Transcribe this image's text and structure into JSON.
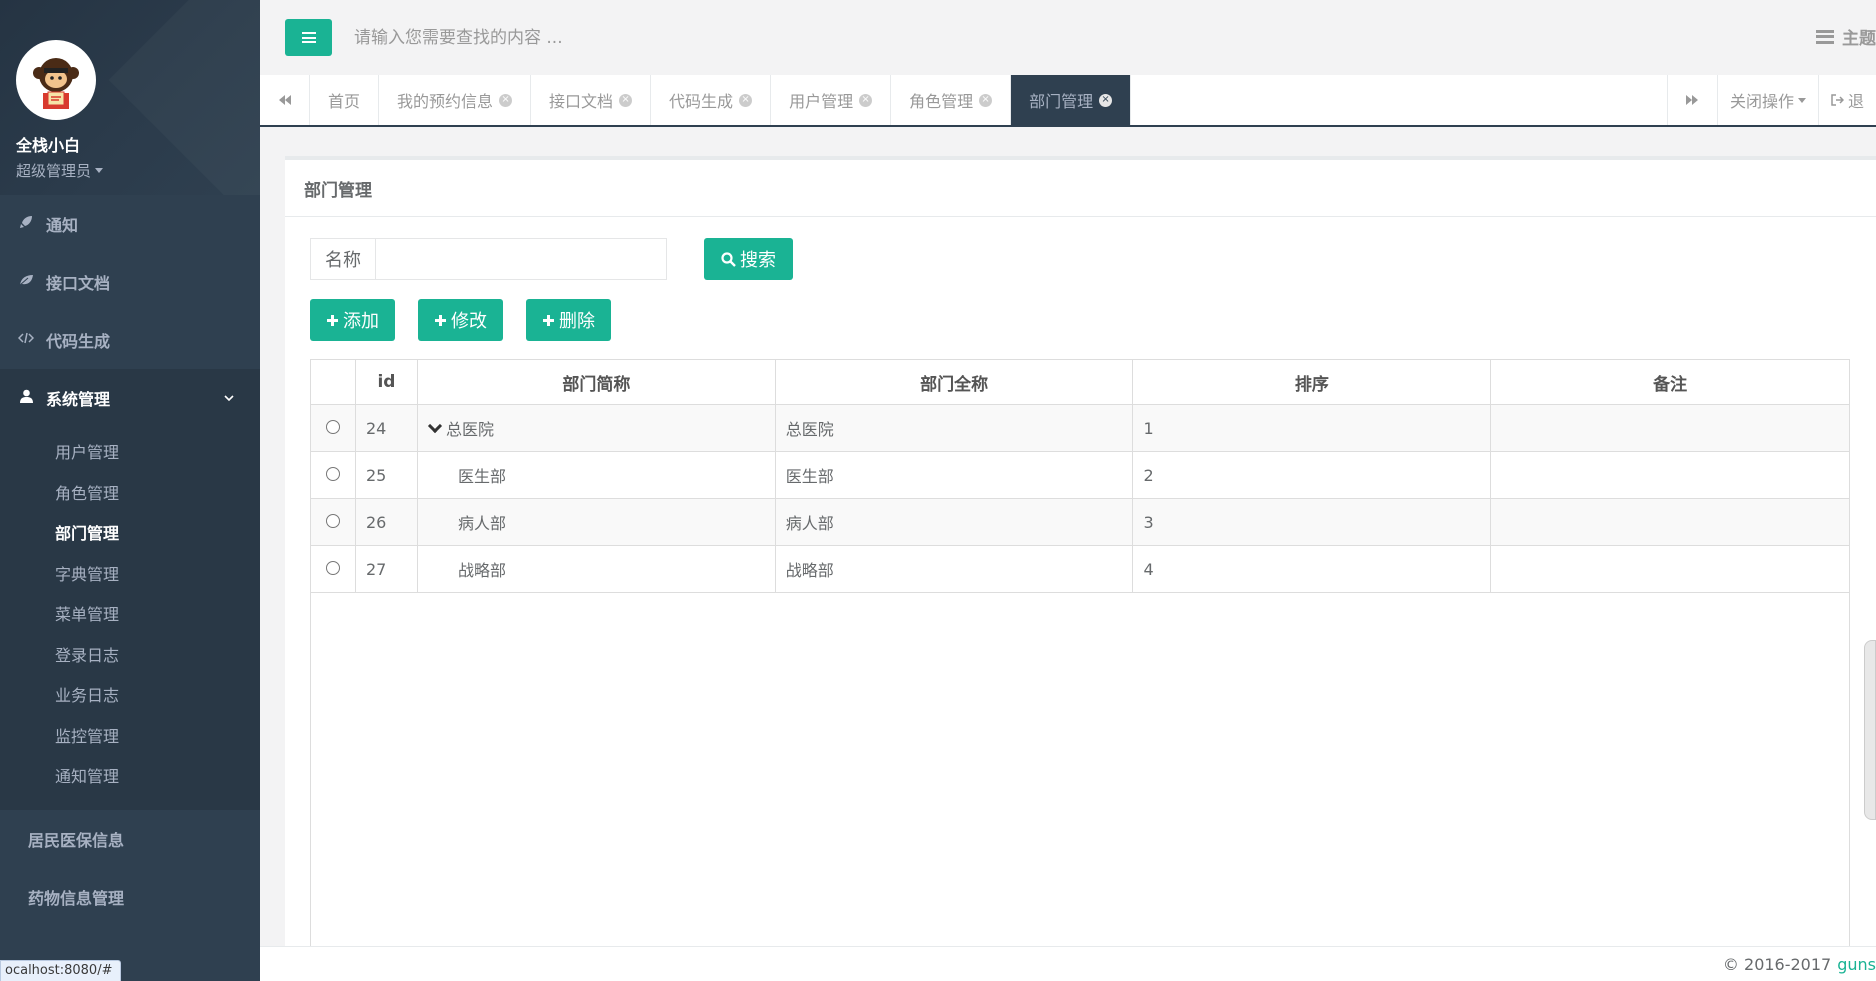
{
  "user": {
    "name": "全栈小白",
    "role": "超级管理员"
  },
  "sidebar": {
    "items": [
      {
        "label": "通知",
        "icon": "rocket-icon"
      },
      {
        "label": "接口文档",
        "icon": "leaf-icon"
      },
      {
        "label": "代码生成",
        "icon": "code-icon"
      },
      {
        "label": "系统管理",
        "icon": "user-icon"
      }
    ],
    "sub_items": [
      "用户管理",
      "角色管理",
      "部门管理",
      "字典管理",
      "菜单管理",
      "登录日志",
      "业务日志",
      "监控管理",
      "通知管理"
    ],
    "extra_items": [
      "居民医保信息",
      "药物信息管理"
    ]
  },
  "status_url": "ocalhost:8080/#",
  "header": {
    "search_placeholder": "请输入您需要查找的内容 ...",
    "theme_label": "主题"
  },
  "tabs": [
    {
      "label": "首页"
    },
    {
      "label": "我的预约信息"
    },
    {
      "label": "接口文档"
    },
    {
      "label": "代码生成"
    },
    {
      "label": "用户管理"
    },
    {
      "label": "角色管理"
    },
    {
      "label": "部门管理"
    }
  ],
  "tabs_right": {
    "close_ops": "关闭操作",
    "logout": "退"
  },
  "panel": {
    "title": "部门管理",
    "name_label": "名称",
    "search_button": "搜索",
    "add_button": "添加",
    "edit_button": "修改",
    "delete_button": "删除"
  },
  "table": {
    "headers": [
      "id",
      "部门简称",
      "部门全称",
      "排序",
      "备注"
    ],
    "rows": [
      {
        "id": "24",
        "short": "总医院",
        "full": "总医院",
        "order": "1",
        "note": ""
      },
      {
        "id": "25",
        "short": "医生部",
        "full": "医生部",
        "order": "2",
        "note": ""
      },
      {
        "id": "26",
        "short": "病人部",
        "full": "病人部",
        "order": "3",
        "note": ""
      },
      {
        "id": "27",
        "short": "战略部",
        "full": "战略部",
        "order": "4",
        "note": ""
      }
    ]
  },
  "footer": {
    "copyright": "© 2016-2017",
    "link": "guns"
  },
  "colors": {
    "primary": "#1ab394",
    "sidebar": "#2f4050"
  }
}
